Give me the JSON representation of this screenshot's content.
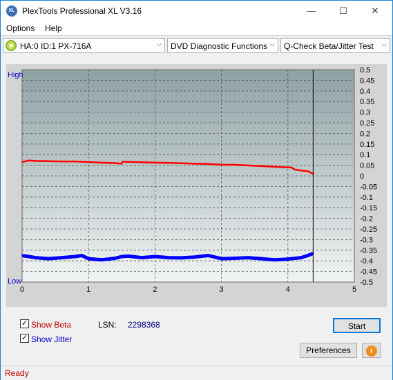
{
  "window": {
    "title": "PlexTools Professional XL V3.16",
    "icon_name": "plextools-xl-icon",
    "minimize_glyph": "—",
    "maximize_glyph": "☐",
    "close_glyph": "✕"
  },
  "menu": {
    "options": "Options",
    "help": "Help"
  },
  "toolbar": {
    "drive": "HA:0 ID:1  PX-716A",
    "function": "DVD Diagnostic Functions",
    "test": "Q-Check Beta/Jitter Test",
    "arrow": "⌵"
  },
  "chart_data": {
    "type": "line",
    "x_ticks": [
      "0",
      "1",
      "2",
      "3",
      "4",
      "5"
    ],
    "xlim": [
      0,
      5
    ],
    "y_right_ticks": [
      "0.5",
      "0.45",
      "0.4",
      "0.35",
      "0.3",
      "0.25",
      "0.2",
      "0.15",
      "0.1",
      "0.05",
      "0",
      "-0.05",
      "-0.1",
      "-0.15",
      "-0.2",
      "-0.25",
      "-0.3",
      "-0.35",
      "-0.4",
      "-0.45",
      "-0.5"
    ],
    "ylim": [
      -0.5,
      0.5
    ],
    "y_left_labels": {
      "high": "High",
      "low": "Low"
    },
    "grid": true,
    "end_marker_x": 4.38,
    "colors": {
      "beta": "#ff0000",
      "jitter": "#0000ff",
      "plot_bg_top": "#8ea1a3",
      "plot_bg_bottom": "#f2f4f4",
      "high_low_label": "#0000cc"
    },
    "series": [
      {
        "name": "Beta",
        "x": [
          0,
          0.1,
          0.2,
          0.4,
          0.6,
          0.8,
          1.0,
          1.2,
          1.4,
          1.5,
          1.51,
          1.6,
          1.8,
          2.0,
          2.2,
          2.4,
          2.6,
          2.8,
          3.0,
          3.2,
          3.4,
          3.6,
          3.8,
          4.0,
          4.05,
          4.1,
          4.2,
          4.3,
          4.38
        ],
        "y": [
          0.065,
          0.072,
          0.07,
          0.069,
          0.068,
          0.068,
          0.065,
          0.062,
          0.06,
          0.057,
          0.067,
          0.066,
          0.064,
          0.062,
          0.061,
          0.059,
          0.057,
          0.056,
          0.053,
          0.052,
          0.049,
          0.046,
          0.043,
          0.04,
          0.04,
          0.03,
          0.025,
          0.022,
          0.01
        ]
      },
      {
        "name": "Jitter",
        "x": [
          0,
          0.1,
          0.2,
          0.4,
          0.6,
          0.8,
          0.9,
          1.0,
          1.2,
          1.4,
          1.5,
          1.6,
          1.8,
          2.0,
          2.2,
          2.4,
          2.6,
          2.8,
          3.0,
          3.2,
          3.4,
          3.6,
          3.8,
          4.0,
          4.2,
          4.3,
          4.38
        ],
        "y": [
          -0.375,
          -0.38,
          -0.385,
          -0.39,
          -0.385,
          -0.38,
          -0.375,
          -0.39,
          -0.395,
          -0.388,
          -0.38,
          -0.378,
          -0.385,
          -0.38,
          -0.385,
          -0.386,
          -0.382,
          -0.375,
          -0.39,
          -0.388,
          -0.385,
          -0.39,
          -0.395,
          -0.392,
          -0.385,
          -0.375,
          -0.365
        ]
      }
    ]
  },
  "controls": {
    "show_beta": "Show Beta",
    "show_jitter": "Show Jitter",
    "check_glyph": "✓",
    "lsn_label": "LSN:",
    "lsn_value": "2298368",
    "start": "Start",
    "preferences": "Preferences",
    "info_glyph": "i"
  },
  "status": {
    "text": "Ready"
  }
}
